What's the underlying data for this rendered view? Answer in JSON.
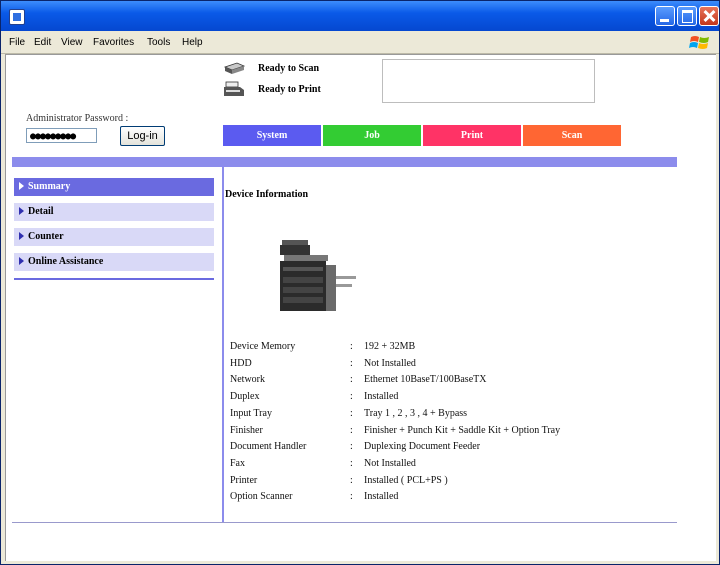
{
  "window": {
    "menu": [
      "File",
      "Edit",
      "View",
      "Favorites",
      "Tools",
      "Help"
    ]
  },
  "status": {
    "scan": "Ready to Scan",
    "print": "Ready to Print"
  },
  "admin": {
    "password_label": "Administrator Password :",
    "password_value": "●●●●●●●●●",
    "login_label": "Log-in"
  },
  "tabs": [
    {
      "label": "System",
      "color": "#5b5bf0"
    },
    {
      "label": "Job",
      "color": "#33cc33"
    },
    {
      "label": "Print",
      "color": "#ff3366"
    },
    {
      "label": "Scan",
      "color": "#ff6633"
    }
  ],
  "nav": [
    {
      "label": "Summary",
      "active": true
    },
    {
      "label": "Detail",
      "active": false
    },
    {
      "label": "Counter",
      "active": false
    },
    {
      "label": "Online Assistance",
      "active": false
    }
  ],
  "device": {
    "title": "Device Information",
    "rows": [
      {
        "label": "Device Memory",
        "value": "192 + 32MB"
      },
      {
        "label": "HDD",
        "value": "Not Installed"
      },
      {
        "label": "Network",
        "value": "Ethernet 10BaseT/100BaseTX"
      },
      {
        "label": "Duplex",
        "value": "Installed"
      },
      {
        "label": "Input Tray",
        "value": "Tray 1 , 2 , 3 , 4 + Bypass"
      },
      {
        "label": "Finisher",
        "value": "Finisher + Punch Kit + Saddle Kit + Option Tray"
      },
      {
        "label": "Document Handler",
        "value": "Duplexing Document Feeder"
      },
      {
        "label": "Fax",
        "value": "Not Installed"
      },
      {
        "label": "Printer",
        "value": "Installed ( PCL+PS )"
      },
      {
        "label": "Option Scanner",
        "value": "Installed"
      }
    ]
  },
  "icons": {
    "app": "browser-icon",
    "scan": "scanner-icon",
    "print": "printer-icon",
    "device": "copier-image",
    "os_logo": "windows-flag-icon"
  }
}
